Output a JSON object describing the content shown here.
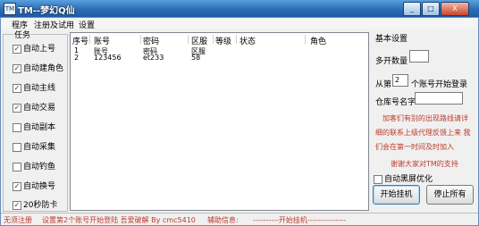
{
  "window": {
    "title": "TM--梦幻Q仙",
    "min": "_",
    "max": "□",
    "close": "X"
  },
  "menu": [
    "程序",
    "注册及试用",
    "设置"
  ],
  "tasks": {
    "title": "任务",
    "items": [
      {
        "label": "自动上号",
        "checked": true
      },
      {
        "label": "自动建角色",
        "checked": true
      },
      {
        "label": "自动主线",
        "checked": true
      },
      {
        "label": "自动交易",
        "checked": true
      },
      {
        "label": "自动副本",
        "checked": false
      },
      {
        "label": "自动采集",
        "checked": false
      },
      {
        "label": "自动钓鱼",
        "checked": false
      },
      {
        "label": "自动换号",
        "checked": true
      },
      {
        "label": "20秒防卡",
        "checked": true
      }
    ]
  },
  "table": {
    "columns": [
      "序号",
      "账号",
      "密码",
      "区服",
      "等级",
      "状态",
      "角色"
    ],
    "rows": [
      [
        "1",
        "账号",
        "密码",
        "区服",
        "",
        "",
        ""
      ],
      [
        "2",
        "123456",
        "et233",
        "58",
        "",
        "",
        ""
      ]
    ]
  },
  "settings": {
    "title": "基本设置",
    "open_count_label": "多开数量",
    "open_count_value": "",
    "start_from_prefix": "从第",
    "start_from_value": "2",
    "start_from_suffix": "个账号开始登录",
    "warehouse_label": "仓库号名字",
    "warehouse_value": "",
    "notice_lines": [
      "加客们有别的出现路线请详",
      "细的联系上级代理反馈上来 我",
      "们会在第一时间及时加入"
    ],
    "thanks": "谢谢大家对TM的支持",
    "black_screen_label": "自动黑屏优化",
    "black_screen_checked": false,
    "start_button": "开始挂机",
    "stop_button": "停止所有"
  },
  "status": {
    "registration": "无须注册",
    "hint": "设置第2个账号开始登陆 吾爱破解 By cmc5410",
    "aux_info": "辅助信息:",
    "aux_message": "----------开始挂机---------------"
  }
}
